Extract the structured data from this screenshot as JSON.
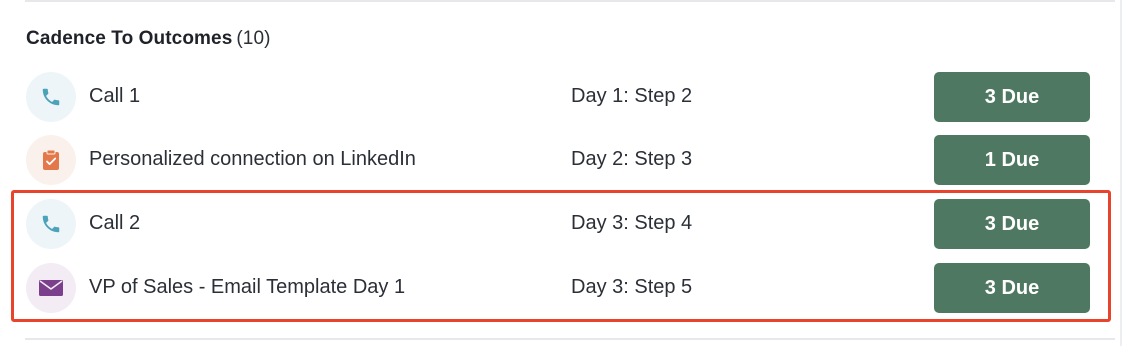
{
  "section": {
    "title": "Cadence To Outcomes",
    "count": "(10)"
  },
  "rows": [
    {
      "icon": "phone-icon",
      "type": "call",
      "name": "Call 1",
      "step": "Day 1: Step 2",
      "due": "3 Due"
    },
    {
      "icon": "clipboard-icon",
      "type": "task",
      "name": "Personalized connection on LinkedIn",
      "step": "Day 2: Step 3",
      "due": "1 Due"
    },
    {
      "icon": "phone-icon",
      "type": "call",
      "name": "Call 2",
      "step": "Day 3: Step 4",
      "due": "3 Due"
    },
    {
      "icon": "envelope-icon",
      "type": "email",
      "name": "VP of Sales - Email Template Day 1",
      "step": "Day 3: Step 5",
      "due": "3 Due"
    }
  ],
  "colors": {
    "due_button": "#4f7862",
    "highlight": "#e8432b",
    "call_icon": "#4aa3b8",
    "task_icon": "#e3794a",
    "email_icon": "#7b3f8c"
  }
}
